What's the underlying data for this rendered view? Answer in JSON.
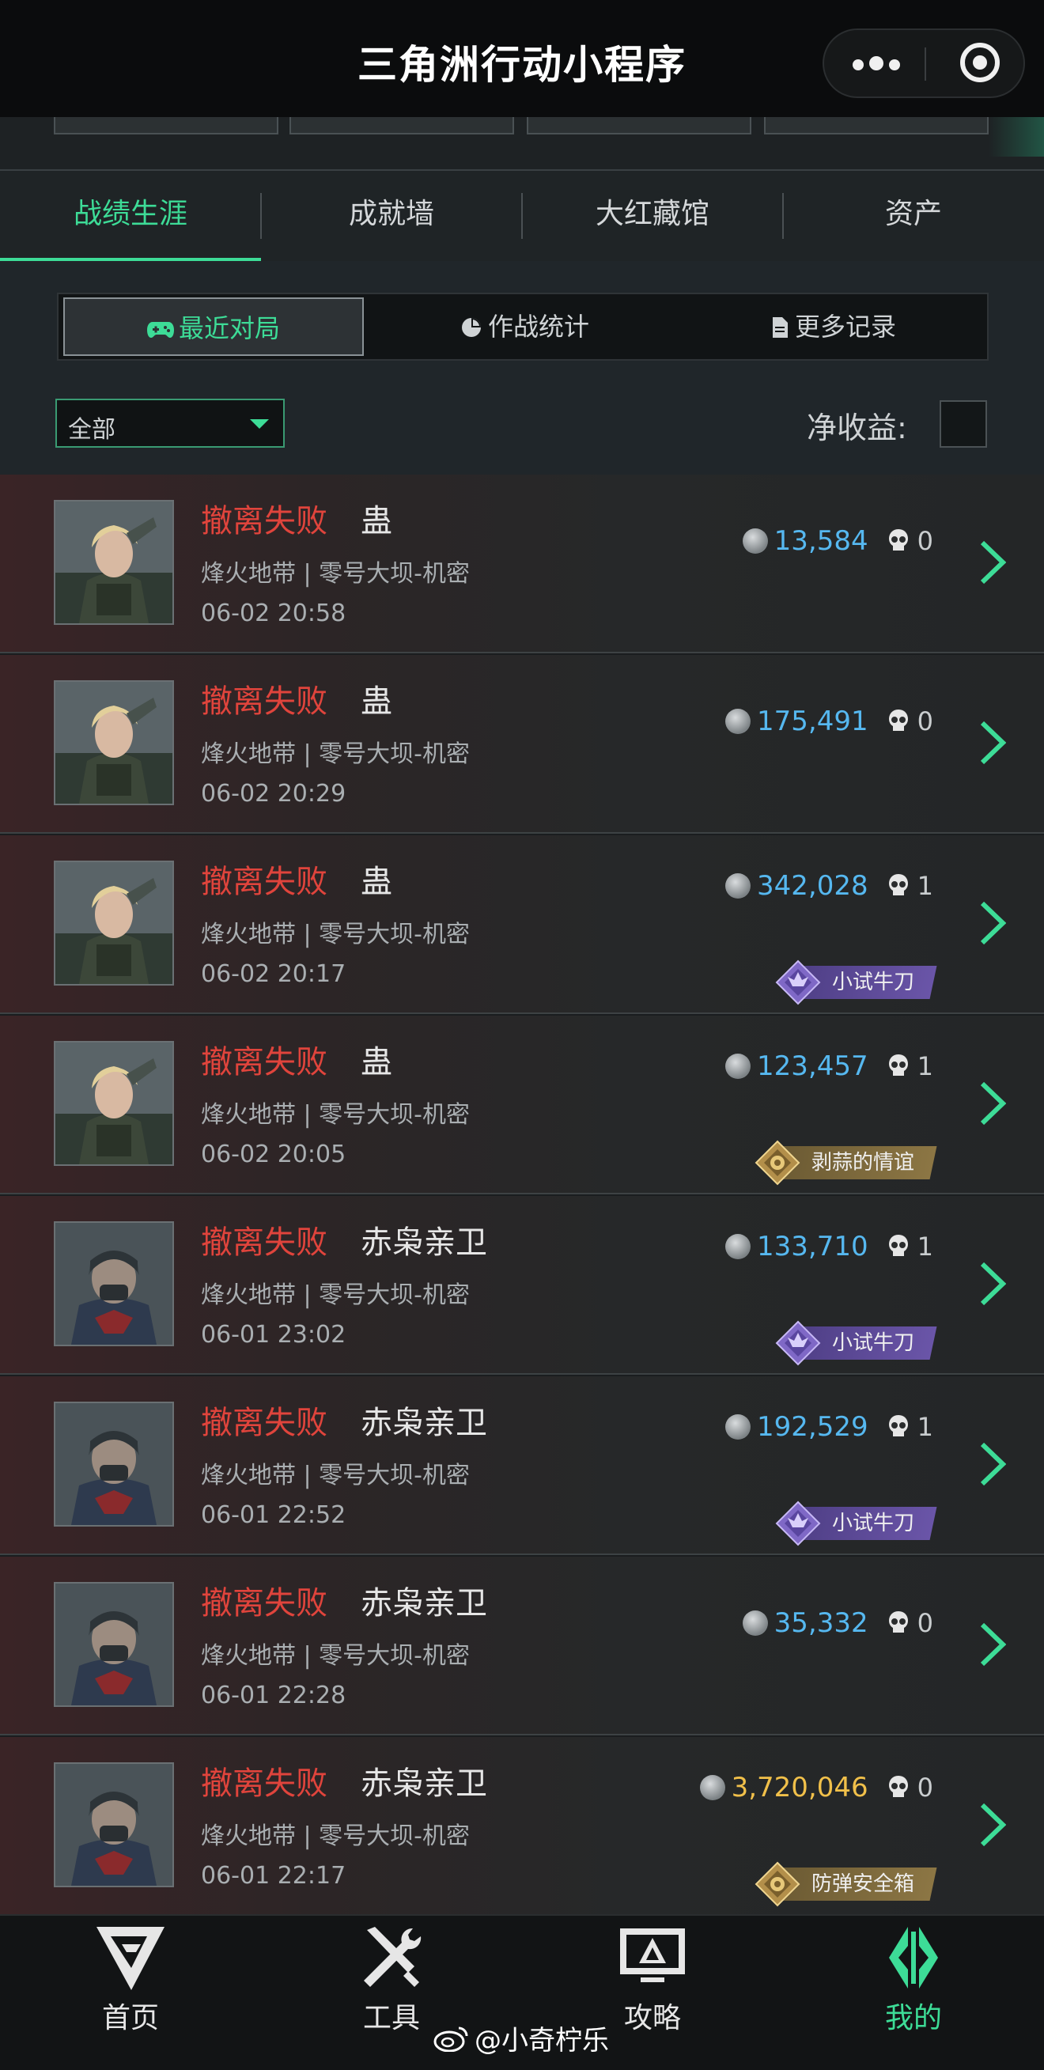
{
  "window": {
    "title": "三角洲行动小程序"
  },
  "tabs": [
    {
      "label": "战绩生涯",
      "active": true
    },
    {
      "label": "成就墙",
      "active": false
    },
    {
      "label": "大红藏馆",
      "active": false
    },
    {
      "label": "资产",
      "active": false
    }
  ],
  "segments": [
    {
      "label": "最近对局",
      "icon": "gamepad-icon",
      "active": true
    },
    {
      "label": "作战统计",
      "icon": "pie-chart-icon",
      "active": false
    },
    {
      "label": "更多记录",
      "icon": "document-icon",
      "active": false
    }
  ],
  "filter": {
    "selected": "全部",
    "net_label": "净收益:"
  },
  "colors": {
    "accent": "#3ddc97",
    "fail": "#e0443c",
    "value": "#56b8f0",
    "value_high": "#f1c04a"
  },
  "matches": [
    {
      "status": "撤离失败",
      "operator": "蛊",
      "map": "烽火地带 | 零号大坝-机密",
      "time": "06-02 20:58",
      "value": "13,584",
      "kills": "0",
      "badge": null
    },
    {
      "status": "撤离失败",
      "operator": "蛊",
      "map": "烽火地带 | 零号大坝-机密",
      "time": "06-02 20:29",
      "value": "175,491",
      "kills": "0",
      "badge": null
    },
    {
      "status": "撤离失败",
      "operator": "蛊",
      "map": "烽火地带 | 零号大坝-机密",
      "time": "06-02 20:17",
      "value": "342,028",
      "kills": "1",
      "badge": {
        "label": "小试牛刀",
        "style": "purple"
      }
    },
    {
      "status": "撤离失败",
      "operator": "蛊",
      "map": "烽火地带 | 零号大坝-机密",
      "time": "06-02 20:05",
      "value": "123,457",
      "kills": "1",
      "badge": {
        "label": "剥蒜的情谊",
        "style": "gold"
      }
    },
    {
      "status": "撤离失败",
      "operator": "赤枭亲卫",
      "map": "烽火地带 | 零号大坝-机密",
      "time": "06-01 23:02",
      "value": "133,710",
      "kills": "1",
      "badge": {
        "label": "小试牛刀",
        "style": "purple"
      }
    },
    {
      "status": "撤离失败",
      "operator": "赤枭亲卫",
      "map": "烽火地带 | 零号大坝-机密",
      "time": "06-01 22:52",
      "value": "192,529",
      "kills": "1",
      "badge": {
        "label": "小试牛刀",
        "style": "purple"
      }
    },
    {
      "status": "撤离失败",
      "operator": "赤枭亲卫",
      "map": "烽火地带 | 零号大坝-机密",
      "time": "06-01 22:28",
      "value": "35,332",
      "kills": "0",
      "badge": null
    },
    {
      "status": "撤离失败",
      "operator": "赤枭亲卫",
      "map": "烽火地带 | 零号大坝-机密",
      "time": "06-01 22:17",
      "value": "3,720,046",
      "kills": "0",
      "badge": {
        "label": "防弹安全箱",
        "style": "gold"
      },
      "highlight": true
    }
  ],
  "nav": [
    {
      "label": "首页",
      "icon": "home-logo-icon",
      "active": false
    },
    {
      "label": "工具",
      "icon": "tools-icon",
      "active": false
    },
    {
      "label": "攻略",
      "icon": "guide-icon",
      "active": false
    },
    {
      "label": "我的",
      "icon": "profile-logo-icon",
      "active": true
    }
  ],
  "watermark": {
    "text": "@小奇柠乐",
    "icon": "weibo-icon"
  }
}
